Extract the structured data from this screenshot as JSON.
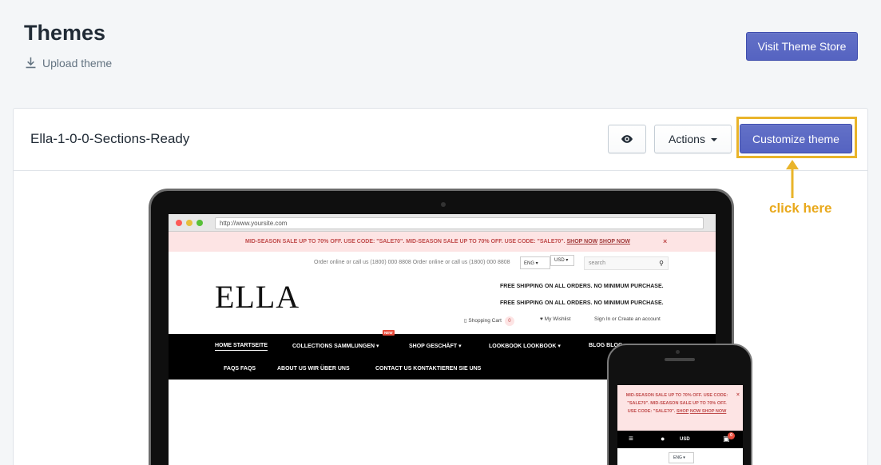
{
  "header": {
    "title": "Themes",
    "upload_label": "Upload theme",
    "visit_store_label": "Visit Theme Store"
  },
  "theme_card": {
    "name": "Ella-1-0-0-Sections-Ready",
    "actions_label": "Actions",
    "customize_label": "Customize theme"
  },
  "annotation": {
    "hint": "click here",
    "color": "#e9a91c"
  },
  "preview": {
    "url": "http://www.yoursite.com",
    "promo": "MID-SEASON SALE UP TO 70% OFF. USE CODE: \"SALE70\". MID-SEASON SALE UP TO 70% OFF. USE CODE: \"SALE70\".",
    "promo_link1": "SHOP NOW",
    "promo_link2": "SHOP NOW",
    "close": "×",
    "contact": "Order online or call us (1800) 000 8808 Order online or call us (1800) 000 8808",
    "lang": "ENG",
    "currency": "USD",
    "search_placeholder": "search",
    "logo": "ELLA",
    "shipping1": "FREE SHIPPING ON ALL ORDERS. NO MINIMUM PURCHASE.",
    "shipping2": "FREE SHIPPING ON ALL ORDERS. NO MINIMUM PURCHASE.",
    "cart_label": "Shopping Cart",
    "cart_count": "0",
    "wishlist_label": "My Wishlist",
    "account_label": "Sign In or Create an account",
    "new_badge": "NEW",
    "nav": [
      "HOME STARTSEITE",
      "COLLECTIONS SAMMLUNGEN",
      "SHOP GESCHÄFT",
      "LOOKBOOK LOOKBOOK",
      "BLOG BLOG",
      "FAQS FAQS",
      "ABOUT US WIR ÜBER UNS",
      "CONTACT US KONTAKTIEREN SIE UNS"
    ]
  },
  "mobile_preview": {
    "promo": "MID-SEASON SALE UP TO 70% OFF. USE CODE: \"SALE70\". MID-SEASON SALE UP TO 70% OFF. USE CODE: \"SALE70\".",
    "promo_link1": "SHOP",
    "promo_link2": "NOW SHOP NOW",
    "close": "×",
    "currency": "USD",
    "cart_count": "0",
    "lang": "ENG"
  },
  "colors": {
    "primary": "#5c6ac4",
    "highlight": "#e9b42a",
    "background": "#f4f6f8"
  }
}
